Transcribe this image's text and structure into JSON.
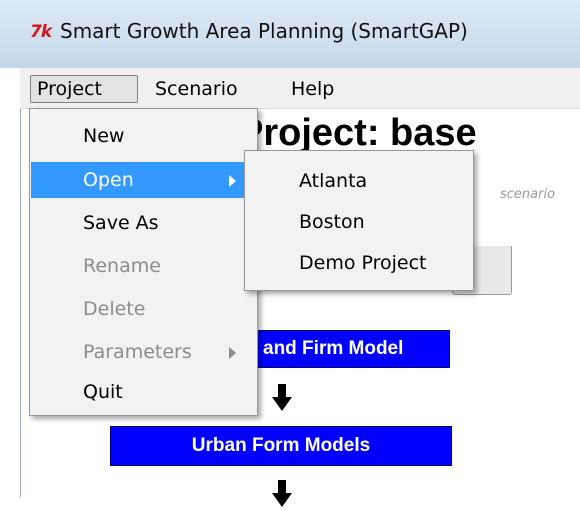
{
  "window": {
    "icon": "7k",
    "title": "Smart Growth Area Planning (SmartGAP)"
  },
  "menubar": {
    "items": [
      {
        "label": "Project"
      },
      {
        "label": "Scenario"
      },
      {
        "label": "Help"
      }
    ]
  },
  "main": {
    "heading": "Project: base",
    "scenario_hint": "scenario",
    "boxes": [
      {
        "label": "and Firm Model"
      },
      {
        "label": "Urban Form Models"
      }
    ],
    "box_color": "#0000ff"
  },
  "project_menu": {
    "items": [
      {
        "label": "New",
        "enabled": true
      },
      {
        "label": "Open",
        "enabled": true,
        "highlighted": true,
        "has_submenu": true
      },
      {
        "label": "Save As",
        "enabled": true
      },
      {
        "label": "Rename",
        "enabled": false
      },
      {
        "label": "Delete",
        "enabled": false
      },
      {
        "label": "Parameters",
        "enabled": false,
        "has_submenu": true
      },
      {
        "label": "Quit",
        "enabled": true
      }
    ],
    "highlight_color": "#3399ff"
  },
  "open_submenu": {
    "items": [
      {
        "label": "Atlanta"
      },
      {
        "label": "Boston"
      },
      {
        "label": "Demo Project"
      }
    ]
  }
}
